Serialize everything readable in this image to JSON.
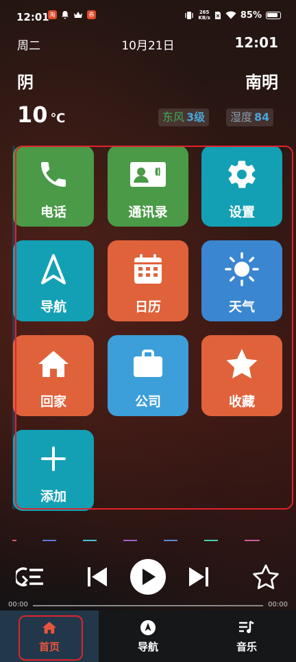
{
  "status_bar": {
    "time": "12:01",
    "notifications": [
      "app-notif-icon",
      "bell-icon",
      "crown-icon",
      "app2-notif-icon"
    ],
    "net_speed_value": "265",
    "net_speed_unit": "KB/s",
    "battery": "85%"
  },
  "header": {
    "weekday": "周二",
    "date": "10月21日",
    "clock": "12:01"
  },
  "weather": {
    "condition": "阴",
    "city": "南明",
    "temperature": "10",
    "temp_unit": "℃",
    "wind_label": "东风",
    "wind_value": "3级",
    "humidity_label": "湿度",
    "humidity_value": "84"
  },
  "tiles": [
    {
      "label": "电话",
      "icon": "phone-icon",
      "color": "#4a9a48"
    },
    {
      "label": "通讯录",
      "icon": "contacts-icon",
      "color": "#4a9a48"
    },
    {
      "label": "设置",
      "icon": "gear-icon",
      "color": "#13a0b4"
    },
    {
      "label": "导航",
      "icon": "navigation-arrow-icon",
      "color": "#13a0b4"
    },
    {
      "label": "日历",
      "icon": "calendar-icon",
      "color": "#e0623b"
    },
    {
      "label": "天气",
      "icon": "sun-icon",
      "color": "#3a86d0"
    },
    {
      "label": "回家",
      "icon": "home-icon",
      "color": "#e0623b"
    },
    {
      "label": "公司",
      "icon": "briefcase-icon",
      "color": "#3c9fd9"
    },
    {
      "label": "收藏",
      "icon": "star-icon",
      "color": "#e0623b"
    },
    {
      "label": "添加",
      "icon": "plus-icon",
      "color": "#13a0b4"
    }
  ],
  "player": {
    "time_start": "00:00",
    "time_end": "00:00",
    "progress": 0,
    "controls": [
      "playlist-loop-icon",
      "previous-icon",
      "play-icon",
      "next-icon",
      "favorite-star-icon"
    ]
  },
  "tabbar": {
    "items": [
      {
        "label": "首页",
        "icon": "home-icon",
        "active": true
      },
      {
        "label": "导航",
        "icon": "compass-icon",
        "active": false
      },
      {
        "label": "音乐",
        "icon": "music-list-icon",
        "active": false
      }
    ]
  },
  "colors": {
    "accent_red": "#e0242a",
    "active_tab_text": "#e8553d",
    "wind_text": "#3fae5a",
    "value_text": "#4aa6d8"
  }
}
